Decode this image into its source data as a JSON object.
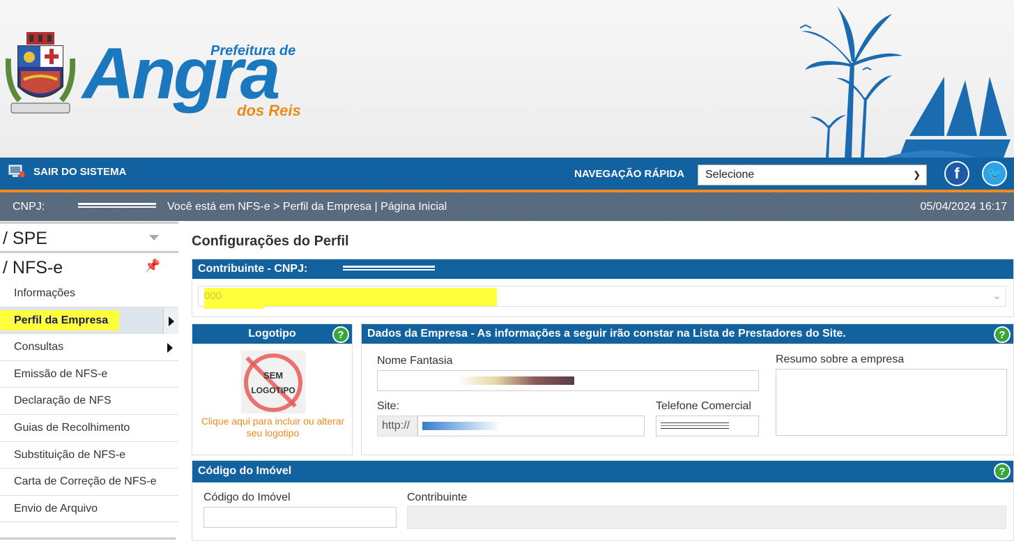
{
  "header": {
    "logo_pre": "Prefeitura de",
    "logo_main": "Angra",
    "logo_sub": "dos Reis"
  },
  "navbar": {
    "exit_label": "SAIR DO SISTEMA",
    "quicknav_label": "NAVEGAÇÃO RÁPIDA",
    "quicknav_value": "Selecione",
    "facebook_glyph": "f",
    "twitter_glyph": "🐦"
  },
  "breadcrumb": {
    "cnpj_label": "CNPJ:",
    "location": "Você está em  NFS-e > Perfil da Empresa  |  Página Inicial",
    "datetime": "05/04/2024 16:17"
  },
  "sidebar": {
    "sections": [
      {
        "title": "/ SPE"
      },
      {
        "title": "/ NFS-e"
      }
    ],
    "items": [
      {
        "label": "Informações"
      },
      {
        "label": "Perfil da Empresa"
      },
      {
        "label": "Consultas"
      },
      {
        "label": "Emissão de NFS-e"
      },
      {
        "label": "Declaração de NFS"
      },
      {
        "label": "Guias de Recolhimento"
      },
      {
        "label": "Substituição de NFS-e"
      },
      {
        "label": "Carta de Correção de NFS-e"
      },
      {
        "label": "Envio de Arquivo"
      }
    ]
  },
  "main": {
    "title": "Configurações do Perfil",
    "contribuinte": {
      "header": "Contribuinte - CNPJ:",
      "select_value": "000"
    },
    "logotipo": {
      "header": "Logotipo",
      "placeholder_line1": "SEM",
      "placeholder_line2": "LOGOTIPO",
      "link_text": "Clique aqui para incluir ou alterar seu logotipo"
    },
    "dados": {
      "header": "Dados da Empresa - As informações a seguir irão constar na Lista de Prestadores do Site.",
      "nome_fantasia_label": "Nome Fantasia",
      "resumo_label": "Resumo sobre a empresa",
      "site_label": "Site:",
      "site_prefix": "http://",
      "telefone_label": "Telefone Comercial"
    },
    "imovel": {
      "header": "Código do Imóvel",
      "codigo_label": "Código do Imóvel",
      "contribuinte_label": "Contribuinte"
    },
    "help_glyph": "?"
  },
  "colors": {
    "primary": "#12629f",
    "accent_orange": "#f38a1b",
    "highlight": "#ffff3b",
    "help_green": "#3aa53a"
  }
}
